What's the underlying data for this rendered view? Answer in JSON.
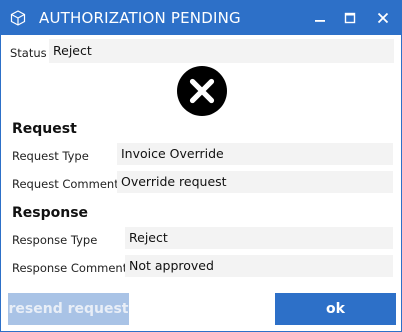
{
  "window": {
    "title": "AUTHORIZATION PENDING",
    "app_icon": "cube-icon",
    "accent_color": "#2d70c8"
  },
  "status": {
    "label": "Status",
    "value": "Reject",
    "icon": "reject-x-icon"
  },
  "request": {
    "heading": "Request",
    "type_label": "Request Type",
    "type_value": "Invoice Override",
    "comment_label": "Request Comment",
    "comment_value": "Override request"
  },
  "response": {
    "heading": "Response",
    "type_label": "Response Type",
    "type_value": "Reject",
    "comment_label": "Response Comment",
    "comment_value": "Not approved"
  },
  "buttons": {
    "resend_label": "resend request",
    "resend_enabled": false,
    "ok_label": "ok"
  }
}
